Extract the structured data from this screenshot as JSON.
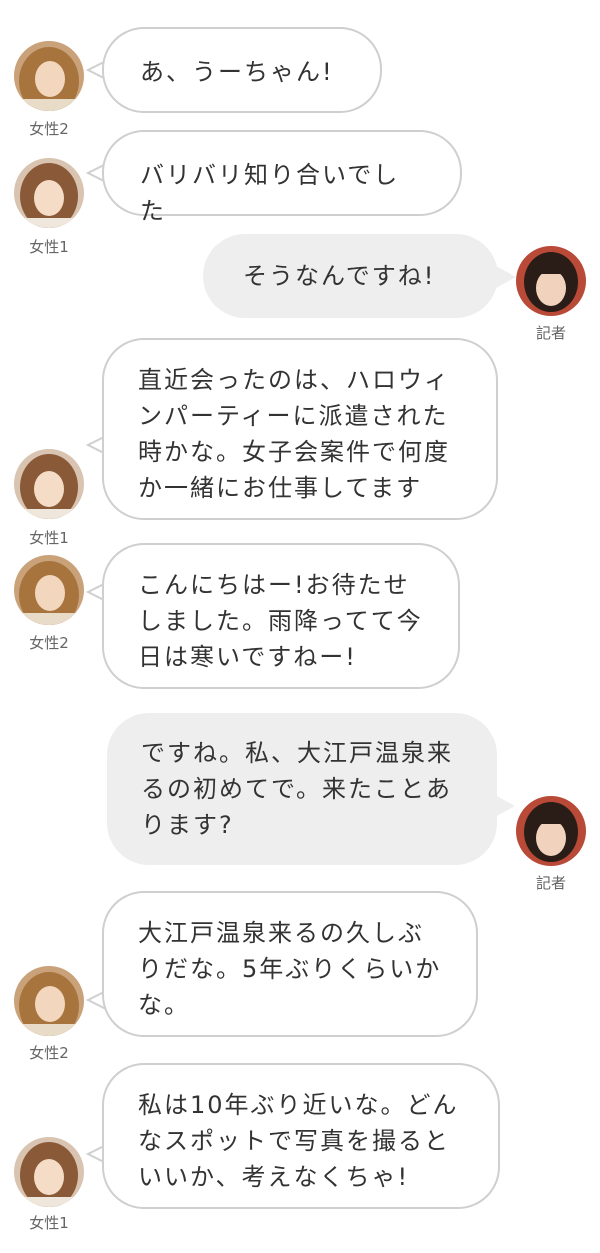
{
  "speakers": {
    "woman1": "女性1",
    "woman2": "女性2",
    "reporter": "記者"
  },
  "colors": {
    "left_bubble_bg": "#ffffff",
    "left_bubble_border": "#cfcfcf",
    "right_bubble_bg": "#eeeeee",
    "text": "#333333"
  },
  "messages": [
    {
      "speaker": "woman2",
      "text": "あ、うーちゃん!"
    },
    {
      "speaker": "woman1",
      "text": "バリバリ知り合いでした"
    },
    {
      "speaker": "reporter",
      "text": "そうなんですね!"
    },
    {
      "speaker": "woman1",
      "text": "直近会ったのは、ハロウィンパーティーに派遣された時かな。女子会案件で何度か一緒にお仕事してます"
    },
    {
      "speaker": "woman2",
      "text": "こんにちはー!お待たせしました。雨降ってて今日は寒いですねー!"
    },
    {
      "speaker": "reporter",
      "text": "ですね。私、大江戸温泉来るの初めてで。来たことあります?"
    },
    {
      "speaker": "woman2",
      "text": "大江戸温泉来るの久しぶりだな。5年ぶりくらいかな。"
    },
    {
      "speaker": "woman1",
      "text": "私は10年ぶり近いな。どんなスポットで写真を撮るといいか、考えなくちゃ!"
    }
  ]
}
